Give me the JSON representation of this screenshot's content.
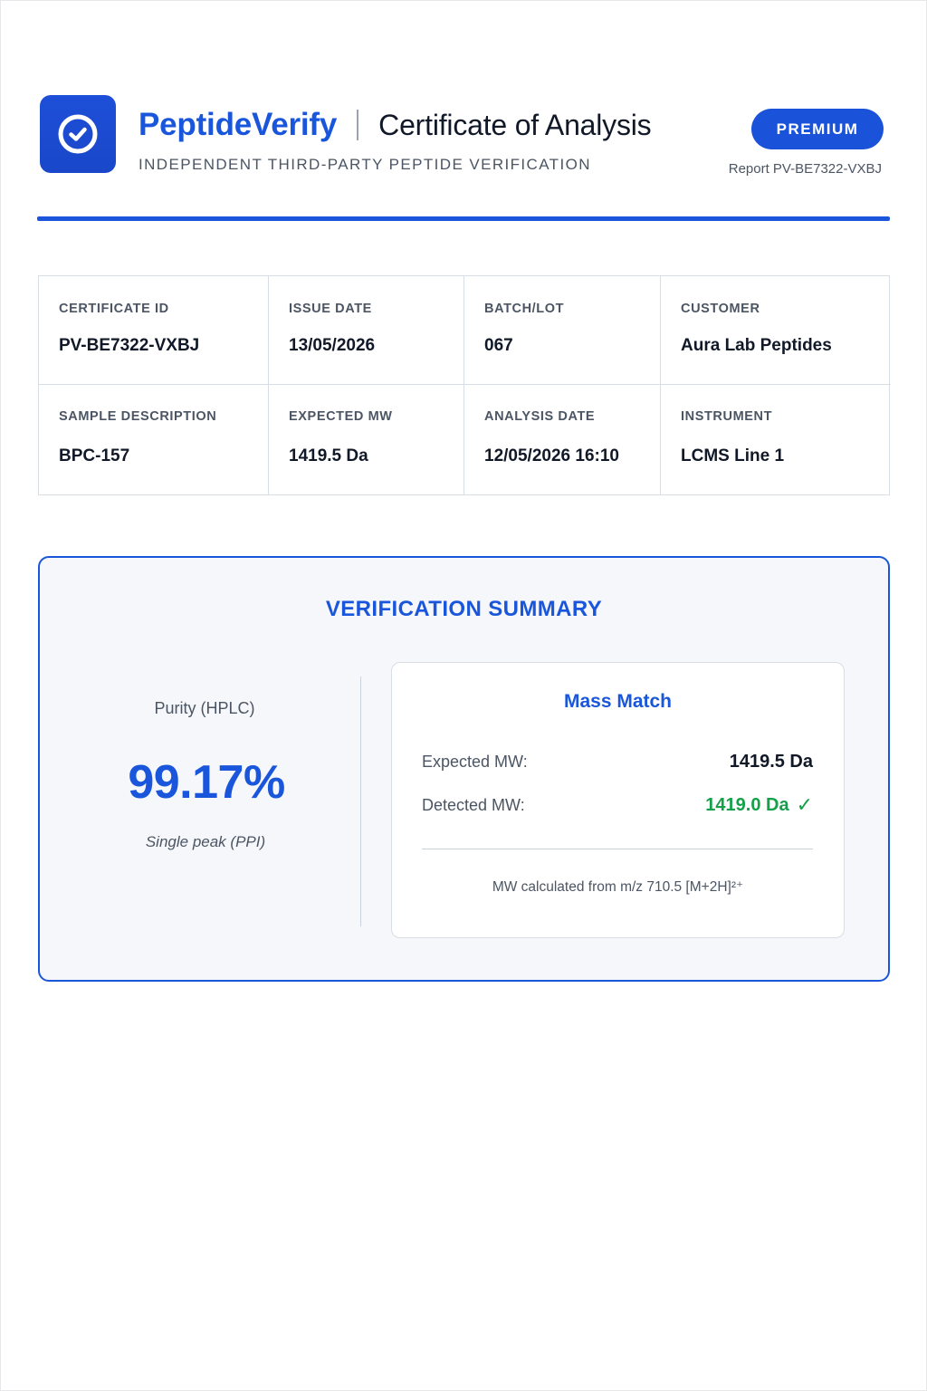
{
  "header": {
    "brand": "PeptideVerify",
    "title": "Certificate of Analysis",
    "tagline": "INDEPENDENT THIRD-PARTY PEPTIDE VERIFICATION",
    "badge": "PREMIUM",
    "report_ref": "Report PV-BE7322-VXBJ",
    "icon": "check-circle-icon"
  },
  "info": {
    "certificate_id": {
      "label": "CERTIFICATE ID",
      "value": "PV-BE7322-VXBJ"
    },
    "issue_date": {
      "label": "ISSUE DATE",
      "value": "13/05/2026"
    },
    "batch_lot": {
      "label": "BATCH/LOT",
      "value": "067"
    },
    "customer": {
      "label": "CUSTOMER",
      "value": "Aura Lab Peptides"
    },
    "sample_description": {
      "label": "SAMPLE DESCRIPTION",
      "value": "BPC-157"
    },
    "expected_mw": {
      "label": "EXPECTED MW",
      "value": "1419.5 Da"
    },
    "analysis_date": {
      "label": "ANALYSIS DATE",
      "value": "12/05/2026 16:10"
    },
    "instrument": {
      "label": "INSTRUMENT",
      "value": "LCMS Line 1"
    }
  },
  "summary": {
    "title": "VERIFICATION SUMMARY",
    "purity_label": "Purity (HPLC)",
    "purity_value": "99.17%",
    "purity_note": "Single peak (PPI)",
    "mass": {
      "title": "Mass Match",
      "expected_label": "Expected MW:",
      "expected_value": "1419.5 Da",
      "detected_label": "Detected MW:",
      "detected_value": "1419.0 Da",
      "detected_icon": "checkmark-icon",
      "footnote": "MW calculated from m/z 710.5 [M+2H]²⁺"
    }
  },
  "colors": {
    "accent": "#1a56db",
    "success": "#15a04a",
    "panel_bg": "#f5f7fb"
  }
}
